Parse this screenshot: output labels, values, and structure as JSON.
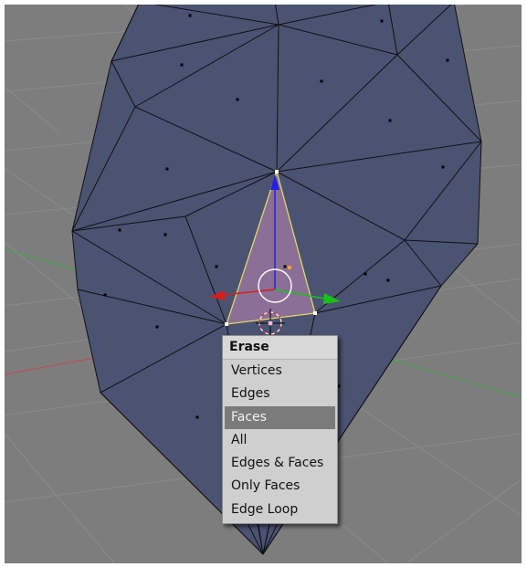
{
  "colors": {
    "viewport_background": "#7d7d7d",
    "grid_line": "#8b8b8b",
    "mesh_face": "#4b5372",
    "mesh_edge": "#111111",
    "selected_face": "#8c6f96",
    "selected_edge": "#e3d864",
    "x_axis": "#c24a4a",
    "y_axis": "#3faa3f",
    "manipulator_x": "#d41d1d",
    "manipulator_y": "#19c019",
    "manipulator_z": "#2222dd",
    "menu_background": "#cfcfcf",
    "menu_highlight": "#7b7b7b"
  },
  "icons": {
    "manipulator": "transform-arrows-icon",
    "cursor": "3d-cursor-icon"
  },
  "erase_menu": {
    "title": "Erase",
    "items": [
      {
        "label": "Vertices",
        "highlighted": false
      },
      {
        "label": "Edges",
        "highlighted": false
      },
      {
        "label": "Faces",
        "highlighted": true
      },
      {
        "label": "All",
        "highlighted": false
      },
      {
        "label": "Edges & Faces",
        "highlighted": false
      },
      {
        "label": "Only Faces",
        "highlighted": false
      },
      {
        "label": "Edge Loop",
        "highlighted": false
      }
    ]
  }
}
